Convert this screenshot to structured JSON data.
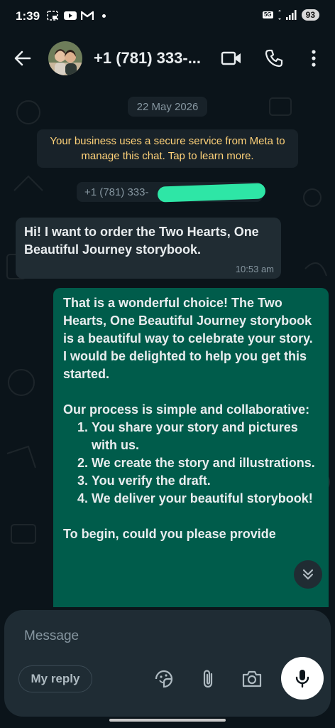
{
  "status_bar": {
    "time": "1:39",
    "network": "5G",
    "battery": "93",
    "icons": [
      "picture-in-picture-icon",
      "youtube-icon",
      "gmail-icon",
      "notification-dot-icon",
      "wifi-icon",
      "signal-icon"
    ]
  },
  "header": {
    "contact_name": "+1 (781) 333-...",
    "actions": [
      "video-call-icon",
      "voice-call-icon",
      "more-options-icon"
    ]
  },
  "chat": {
    "date_chip": "22 May 2026",
    "system_message": "Your business uses a secure service from Meta to manage this chat. Tap to learn more.",
    "phone_chip": "+1 (781) 333-",
    "incoming": {
      "text": "Hi! I want to order the Two Hearts, One Beautiful Journey storybook.",
      "time": "10:53 am"
    },
    "outgoing": {
      "para1": "That is a wonderful choice! The Two Hearts, One Beautiful Journey storybook is a beautiful way to celebrate your story. I would be delighted to help you get this started.",
      "para2": "Our process is simple and collaborative:",
      "steps": [
        "You share your story and pictures with us.",
        "We create the story and illustrations.",
        "You verify the draft.",
        "We deliver your beautiful storybook!"
      ],
      "para3": "To begin, could you please provide"
    }
  },
  "composer": {
    "placeholder": "Message",
    "my_reply": "My reply"
  },
  "colors": {
    "background": "#0b141a",
    "incoming_bubble": "#202c33",
    "outgoing_bubble": "#005c4b",
    "system_text": "#ffd279",
    "redaction": "#2ee6a6"
  }
}
